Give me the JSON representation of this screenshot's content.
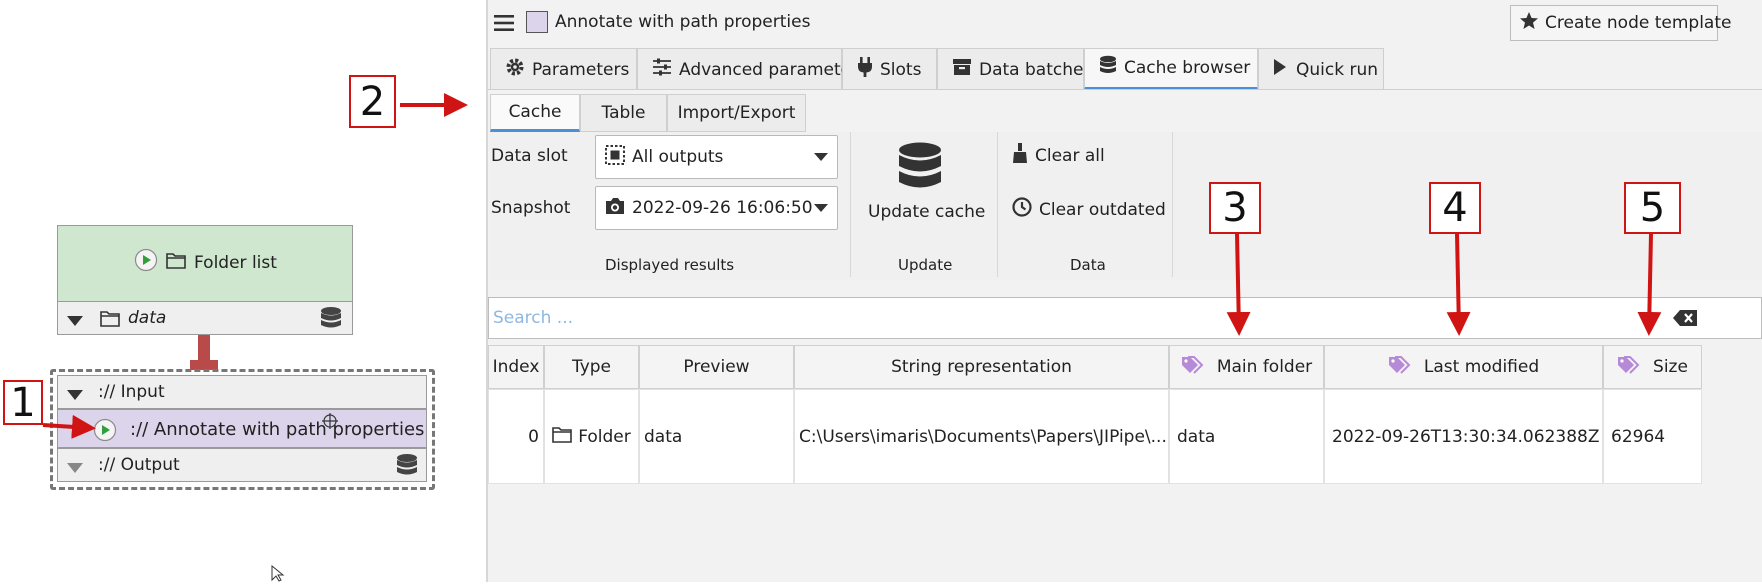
{
  "graph": {
    "folder_node": {
      "title": "Folder list",
      "output_slot": "data"
    },
    "annotate_node": {
      "input_label": ":// Input",
      "title": ":// Annotate with path properties",
      "output_label": ":// Output"
    }
  },
  "header": {
    "node_title": "Annotate with path properties",
    "create_template_label": "Create node template"
  },
  "tabs": [
    {
      "label": "Parameters",
      "icon": "gear-icon"
    },
    {
      "label": "Advanced parameters",
      "icon": "sliders-icon"
    },
    {
      "label": "Slots",
      "icon": "plug-icon"
    },
    {
      "label": "Data batches",
      "icon": "archive-icon"
    },
    {
      "label": "Cache browser",
      "icon": "database-icon"
    },
    {
      "label": "Quick run",
      "icon": "play-icon"
    }
  ],
  "subtabs": [
    {
      "label": "Cache"
    },
    {
      "label": "Table"
    },
    {
      "label": "Import/Export"
    }
  ],
  "toolbar": {
    "data_slot_label": "Data slot",
    "data_slot_value": "All outputs",
    "snapshot_label": "Snapshot",
    "snapshot_value": "2022-09-26 16:06:50",
    "displayed_results_label": "Displayed results",
    "update_cache_label": "Update cache",
    "update_group_label": "Update",
    "clear_all_label": "Clear all",
    "clear_outdated_label": "Clear outdated",
    "data_group_label": "Data"
  },
  "search": {
    "placeholder": "Search ..."
  },
  "table": {
    "columns": [
      "Index",
      "Type",
      "Preview",
      "String representation",
      "Main folder",
      "Last modified",
      "Size"
    ],
    "rows": [
      {
        "index": "0",
        "type": "Folder",
        "preview": "data",
        "string_representation": "C:\\Users\\imaris\\Documents\\Papers\\JIPipe\\...",
        "main_folder": "data",
        "last_modified": "2022-09-26T13:30:34.062388Z",
        "size": "62964"
      }
    ]
  },
  "callouts": [
    "1",
    "2",
    "3",
    "4",
    "5"
  ],
  "colors": {
    "accent": "#4a8fd8",
    "annotation_red": "#d01414",
    "node_green": "#cfe6cf",
    "node_purple": "#dcd4ea",
    "tag_purple": "#b68ad6"
  }
}
